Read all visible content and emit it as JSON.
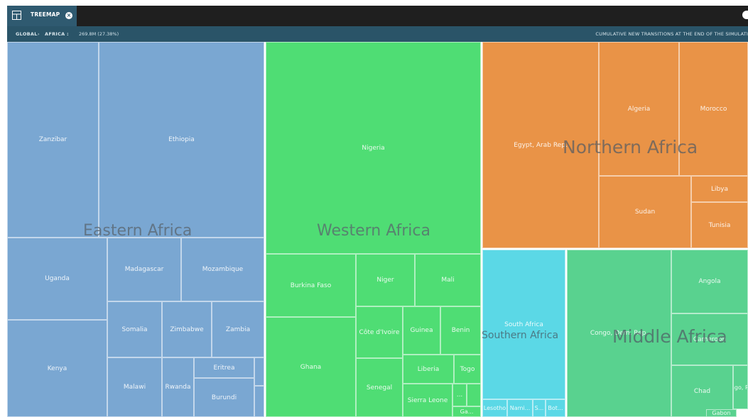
{
  "tab": {
    "label": "TREEMAP",
    "close_icon": "close-icon",
    "icon": "treemap-icon"
  },
  "breadcrumb": {
    "global": "GLOBAL",
    "separator": "›",
    "africa": "AFRICA :",
    "value": "269.8M (27.38%)",
    "right": "CUMULATIVE NEW TRANSITIONS AT THE END OF THE SIMULATI"
  },
  "colors": {
    "eastern": "#7aa7d2",
    "western": "#4fdd74",
    "northern": "#e99347",
    "southern": "#5bd8e6",
    "middle": "#59d28f",
    "header": "#2a5468",
    "titlebar": "#1f1f1f"
  },
  "regions": {
    "eastern": {
      "label": "Eastern Africa",
      "countries": {
        "zanzibar": "Zanzibar",
        "ethiopia": "Ethiopia",
        "uganda": "Uganda",
        "madagascar": "Madagascar",
        "mozambique": "Mozambique",
        "kenya": "Kenya",
        "somalia": "Somalia",
        "zimbabwe": "Zimbabwe",
        "zambia": "Zambia",
        "malawi": "Malawi",
        "rwanda": "Rwanda",
        "eritrea": "Eritrea",
        "burundi": "Burundi"
      }
    },
    "western": {
      "label": "Western Africa",
      "countries": {
        "nigeria": "Nigeria",
        "burkina_faso": "Burkina Faso",
        "niger": "Niger",
        "mali": "Mali",
        "cote_divoire": "Côte d'Ivoire",
        "guinea": "Guinea",
        "benin": "Benin",
        "ghana": "Ghana",
        "senegal": "Senegal",
        "liberia": "Liberia",
        "togo": "Togo",
        "sierra_leone": "Sierra Leone",
        "more": "...",
        "ga": "Ga..."
      }
    },
    "northern": {
      "label": "Northern Africa",
      "countries": {
        "egypt": "Egypt, Arab Rep.",
        "algeria": "Algeria",
        "morocco": "Morocco",
        "sudan": "Sudan",
        "libya": "Libya",
        "tunisia": "Tunisia"
      }
    },
    "southern": {
      "label": "Southern Africa",
      "countries": {
        "south_africa": "South Africa",
        "lesotho": "Lesotho",
        "namibia": "Nami...",
        "s": "S...",
        "botswana": "Bot..."
      }
    },
    "middle": {
      "label": "Middle Africa",
      "countries": {
        "congo": "Congo, Dem. Rep.",
        "angola": "Angola",
        "cameroon": "Cameroon",
        "chad": "Chad",
        "congo_rep": "Congo, Rep.",
        "gabon": "Gabon"
      }
    }
  }
}
